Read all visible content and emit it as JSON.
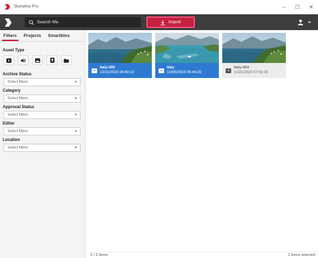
{
  "window": {
    "title": "Stoneline Pro",
    "controls": [
      "–",
      "☐",
      "✕"
    ]
  },
  "toolbar": {
    "search_placeholder": "Search Me",
    "import_label": "Import",
    "accent": "#c4213f"
  },
  "sidebar": {
    "tabs": [
      {
        "label": "Filters",
        "active": true
      },
      {
        "label": "Projects",
        "active": false
      },
      {
        "label": "Smartbins",
        "active": false
      }
    ],
    "asset_type_label": "Asset Type",
    "asset_types": [
      "video-icon",
      "audio-icon",
      "image-icon",
      "document-icon",
      "folder-icon"
    ],
    "filters": [
      {
        "label": "Archive Status",
        "value": "Select filters"
      },
      {
        "label": "Category",
        "value": "Select filters"
      },
      {
        "label": "Approval Status",
        "value": "Select filters"
      },
      {
        "label": "Editor",
        "value": "Select filters"
      },
      {
        "label": "Location",
        "value": "Select filters"
      }
    ]
  },
  "assets": [
    {
      "name": "Italy-005",
      "date": "12/11/2023 08:40:12",
      "selected": true
    },
    {
      "name": "Italy",
      "date": "12/05/2023 05:44:20",
      "selected": true
    },
    {
      "name": "Italy-003",
      "date": "11/21/2023 07:59:33",
      "selected": false
    }
  ],
  "status": {
    "count": "3 / 3 Items",
    "selection": "2 items selected"
  }
}
